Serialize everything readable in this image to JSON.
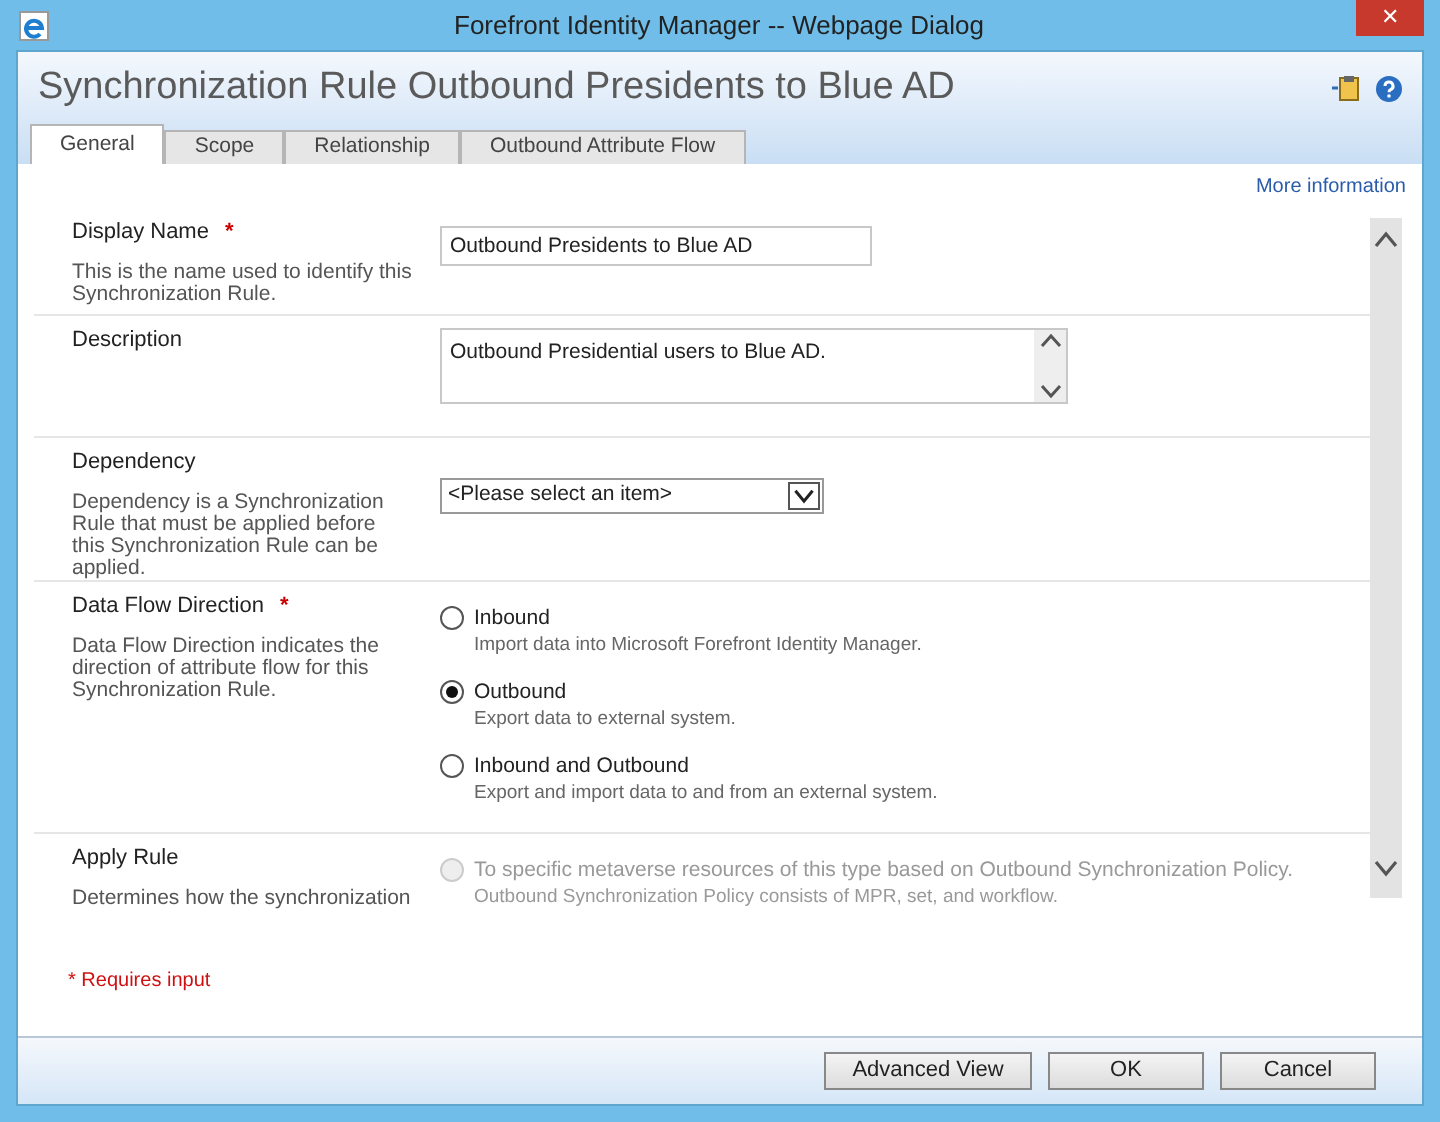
{
  "window": {
    "title": "Forefront Identity Manager -- Webpage Dialog",
    "close": "✕"
  },
  "header": {
    "title": "Synchronization Rule Outbound Presidents to Blue AD"
  },
  "tabs": [
    {
      "label": "General",
      "selected": true
    },
    {
      "label": "Scope",
      "selected": false
    },
    {
      "label": "Relationship",
      "selected": false
    },
    {
      "label": "Outbound Attribute Flow",
      "selected": false
    }
  ],
  "more_info": "More information",
  "fields": [
    {
      "kind": "text",
      "label": "Display Name",
      "required_mark": "*",
      "help": "This is the name used to identify this Synchronization Rule.",
      "value": "Outbound Presidents to Blue AD"
    },
    {
      "kind": "textarea",
      "label": "Description",
      "value": "Outbound Presidential users to Blue AD."
    },
    {
      "kind": "select",
      "label": "Dependency",
      "help": "Dependency is a Synchronization Rule that must be applied before this Synchronization Rule can be applied.",
      "value": "<Please select an item>"
    },
    {
      "kind": "radio",
      "label": "Data Flow Direction",
      "required_mark": "*",
      "help": "Data Flow Direction indicates the direction of attribute flow for this Synchronization Rule.",
      "options": [
        {
          "label": "Inbound",
          "detail": "Import data into Microsoft Forefront Identity Manager.",
          "selected": false,
          "disabled": false
        },
        {
          "label": "Outbound",
          "detail": "Export data to external system.",
          "selected": true,
          "disabled": false
        },
        {
          "label": "Inbound and Outbound",
          "detail": "Export and import data to and from an external system.",
          "selected": false,
          "disabled": false
        }
      ]
    },
    {
      "kind": "radio",
      "label": "Apply Rule",
      "help": "Determines how the synchronization",
      "options": [
        {
          "label": "To specific metaverse resources of this type based on Outbound Synchronization Policy.",
          "detail": "Outbound Synchronization Policy consists of MPR, set, and workflow.",
          "selected": false,
          "disabled": true
        }
      ]
    }
  ],
  "required_note": "* Requires input",
  "buttons": [
    "Advanced View",
    "OK",
    "Cancel"
  ]
}
